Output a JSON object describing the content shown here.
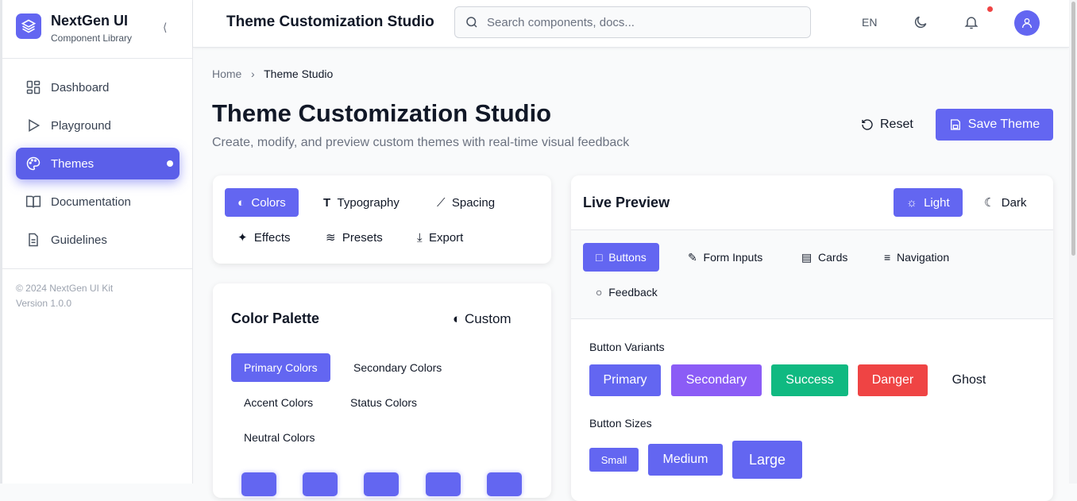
{
  "sidebar": {
    "brand": "NextGen UI",
    "subtitle": "Component Library",
    "items": [
      {
        "label": "Dashboard"
      },
      {
        "label": "Playground"
      },
      {
        "label": "Themes"
      },
      {
        "label": "Documentation"
      },
      {
        "label": "Guidelines"
      }
    ],
    "copyright": "© 2024 NextGen UI Kit",
    "version": "Version 1.0.0"
  },
  "header": {
    "title": "Theme Customization Studio",
    "search_placeholder": "Search components, docs...",
    "lang": "EN"
  },
  "breadcrumb": {
    "home": "Home",
    "current": "Theme Studio"
  },
  "page": {
    "title": "Theme Customization Studio",
    "subtitle": "Create, modify, and preview custom themes with real-time visual feedback",
    "reset": "Reset",
    "save": "Save Theme"
  },
  "editor_tabs": [
    "Colors",
    "Typography",
    "Spacing",
    "Effects",
    "Presets",
    "Export"
  ],
  "palette": {
    "title": "Color Palette",
    "custom": "Custom",
    "groups": [
      "Primary Colors",
      "Secondary Colors",
      "Accent Colors",
      "Status Colors",
      "Neutral Colors"
    ]
  },
  "preview": {
    "title": "Live Preview",
    "light": "Light",
    "dark": "Dark",
    "tabs": [
      "Buttons",
      "Form Inputs",
      "Cards",
      "Navigation",
      "Feedback"
    ],
    "variants_label": "Button Variants",
    "variants": [
      "Primary",
      "Secondary",
      "Success",
      "Danger",
      "Ghost"
    ],
    "sizes_label": "Button Sizes",
    "sizes": [
      "Small",
      "Medium",
      "Large"
    ]
  },
  "colors": {
    "primary": "#6366f1",
    "secondary": "#8b5cf6",
    "success": "#10b981",
    "danger": "#ef4444"
  }
}
